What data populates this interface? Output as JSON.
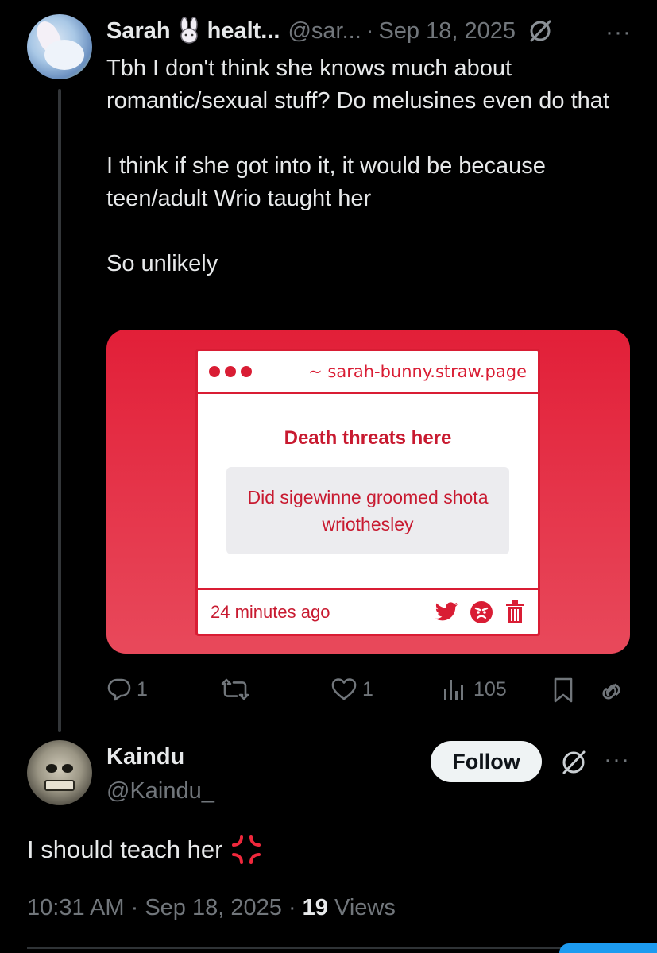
{
  "tweet1": {
    "display_name": "Sarah",
    "name_suffix": "healt...",
    "handle": "@sar...",
    "separator": "·",
    "date": "Sep 18, 2025",
    "more": "···",
    "paragraphs": [
      "Tbh I don't think she knows much about romantic/sexual stuff? Do melusines even do that",
      "I think if she got into it, it would be because teen/adult Wrio taught her",
      "So unlikely"
    ],
    "card": {
      "url": "~ sarah-bunny.straw.page",
      "title": "Death threats here",
      "message": "Did sigewinne groomed shota wriothesley",
      "time_ago": "24 minutes ago"
    },
    "actions": {
      "replies": "1",
      "reposts": "",
      "likes": "1",
      "views": "105"
    }
  },
  "tweet2": {
    "display_name": "Kaindu",
    "handle": "@Kaindu_",
    "follow_label": "Follow",
    "more": "···",
    "text": "I should teach her",
    "time": "10:31 AM",
    "separator": "·",
    "date": "Sep 18, 2025",
    "views_count": "19",
    "views_label": "Views"
  },
  "colors": {
    "background": "#000000",
    "text": "#e7e9ea",
    "secondary": "#71767b",
    "card_red": "#e21f38",
    "follow_bg": "#eff3f4"
  }
}
